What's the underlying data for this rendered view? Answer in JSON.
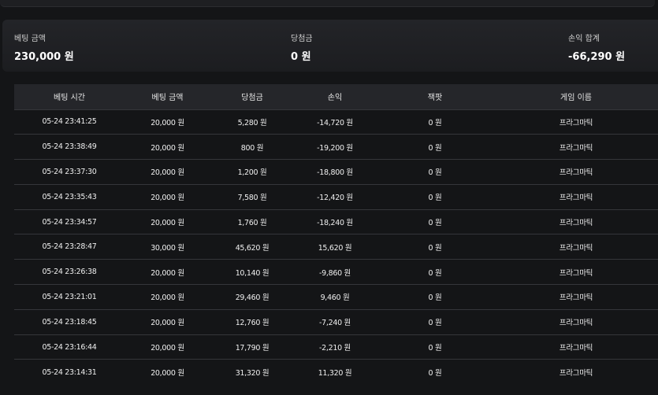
{
  "summary": {
    "bet_amount_label": "베팅 금액",
    "bet_amount_value": "230,000 원",
    "winnings_label": "당첨금",
    "winnings_value": "0 원",
    "profit_total_label": "손익 합계",
    "profit_total_value": "-66,290 원"
  },
  "table": {
    "headers": [
      "베팅 시간",
      "베팅 금액",
      "당첨금",
      "손익",
      "잭팟",
      "게임 이름"
    ],
    "rows": [
      [
        "05-24 23:41:25",
        "20,000 원",
        "5,280 원",
        "-14,720 원",
        "0 원",
        "프라그마틱"
      ],
      [
        "05-24 23:38:49",
        "20,000 원",
        "800 원",
        "-19,200 원",
        "0 원",
        "프라그마틱"
      ],
      [
        "05-24 23:37:30",
        "20,000 원",
        "1,200 원",
        "-18,800 원",
        "0 원",
        "프라그마틱"
      ],
      [
        "05-24 23:35:43",
        "20,000 원",
        "7,580 원",
        "-12,420 원",
        "0 원",
        "프라그마틱"
      ],
      [
        "05-24 23:34:57",
        "20,000 원",
        "1,760 원",
        "-18,240 원",
        "0 원",
        "프라그마틱"
      ],
      [
        "05-24 23:28:47",
        "30,000 원",
        "45,620 원",
        "15,620 원",
        "0 원",
        "프라그마틱"
      ],
      [
        "05-24 23:26:38",
        "20,000 원",
        "10,140 원",
        "-9,860 원",
        "0 원",
        "프라그마틱"
      ],
      [
        "05-24 23:21:01",
        "20,000 원",
        "29,460 원",
        "9,460 원",
        "0 원",
        "프라그마틱"
      ],
      [
        "05-24 23:18:45",
        "20,000 원",
        "12,760 원",
        "-7,240 원",
        "0 원",
        "프라그마틱"
      ],
      [
        "05-24 23:16:44",
        "20,000 원",
        "17,790 원",
        "-2,210 원",
        "0 원",
        "프라그마틱"
      ],
      [
        "05-24 23:14:31",
        "20,000 원",
        "31,320 원",
        "11,320 원",
        "0 원",
        "프라그마틱"
      ]
    ]
  }
}
